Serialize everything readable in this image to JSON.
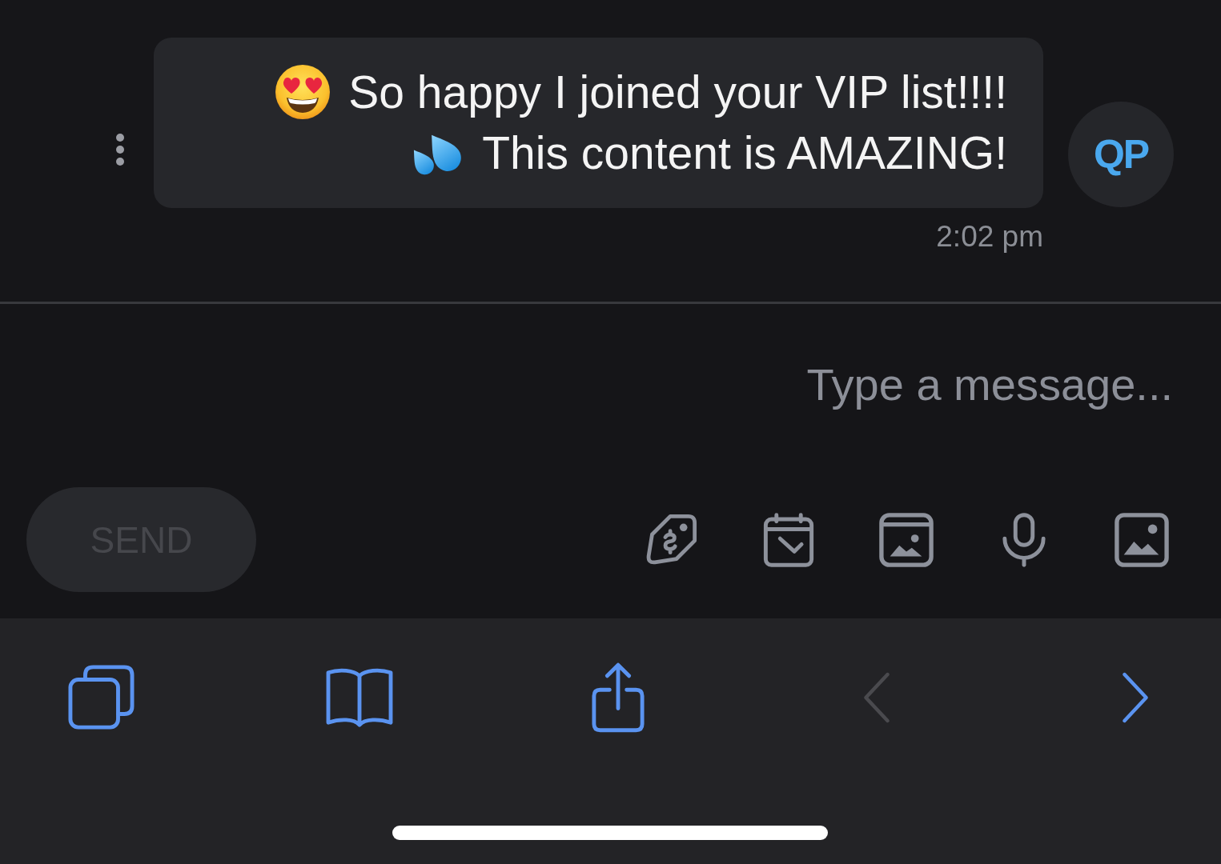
{
  "message": {
    "sender": {
      "initials": "QP"
    },
    "lines": [
      "So happy I joined your VIP list!!!!",
      "This content is AMAZING!"
    ],
    "time": "2:02 pm"
  },
  "composer": {
    "placeholder": "Type a message...",
    "send": {
      "label": "SEND",
      "disabled": true
    }
  },
  "browser_toolbar": {
    "chevron_left": {
      "disabled": true
    },
    "chevron_right": {
      "disabled": false
    }
  }
}
